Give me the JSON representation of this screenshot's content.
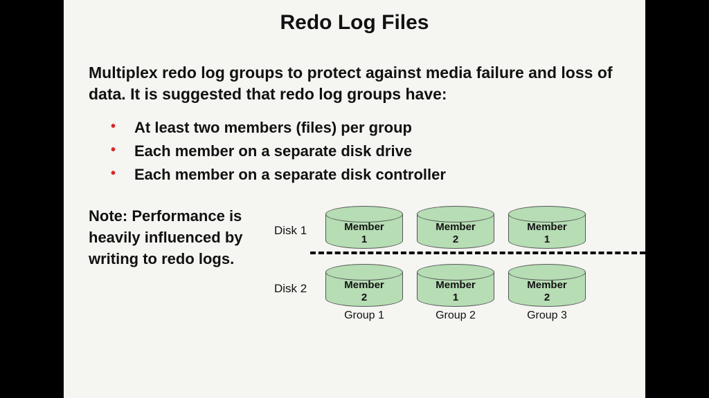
{
  "title": "Redo Log Files",
  "intro": "Multiplex redo log groups to protect against media failure and loss of data. It is suggested that redo log groups have:",
  "bullets": [
    "At least two members (files) per group",
    "Each member on a separate disk drive",
    "Each member on a separate disk controller"
  ],
  "note": "Note: Performance is heavily influenced by writing to redo logs.",
  "diagram": {
    "disk_labels": [
      "Disk 1",
      "Disk 2"
    ],
    "row1": [
      {
        "line1": "Member",
        "line2": "1"
      },
      {
        "line1": "Member",
        "line2": "2"
      },
      {
        "line1": "Member",
        "line2": "1"
      }
    ],
    "row2": [
      {
        "line1": "Member",
        "line2": "2"
      },
      {
        "line1": "Member",
        "line2": "1"
      },
      {
        "line1": "Member",
        "line2": "2"
      }
    ],
    "groups": [
      "Group 1",
      "Group 2",
      "Group 3"
    ]
  }
}
